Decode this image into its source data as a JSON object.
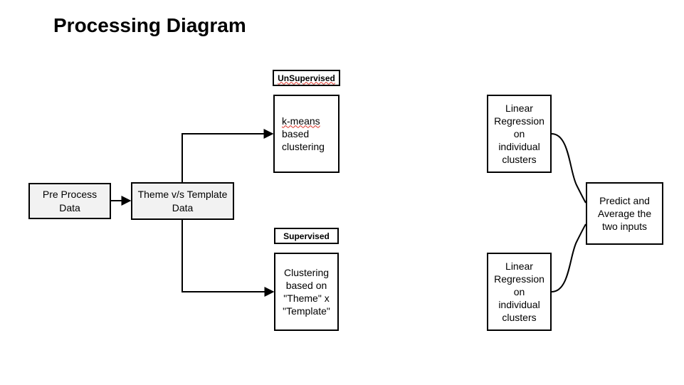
{
  "title": "Processing Diagram",
  "boxes": {
    "preprocess": "Pre Process Data",
    "theme_template": "Theme v/s Template Data",
    "unsupervised_label": "UnSupervised",
    "kmeans_prefix": "k-means",
    "kmeans_rest": " based clustering",
    "supervised_label": "Supervised",
    "clustering_theme": "Clustering based on \"Theme\" x \"Template\"",
    "lr_top": "Linear Regression on individual clusters",
    "lr_bottom": "Linear Regression on individual clusters",
    "predict": "Predict and Average the two inputs"
  }
}
